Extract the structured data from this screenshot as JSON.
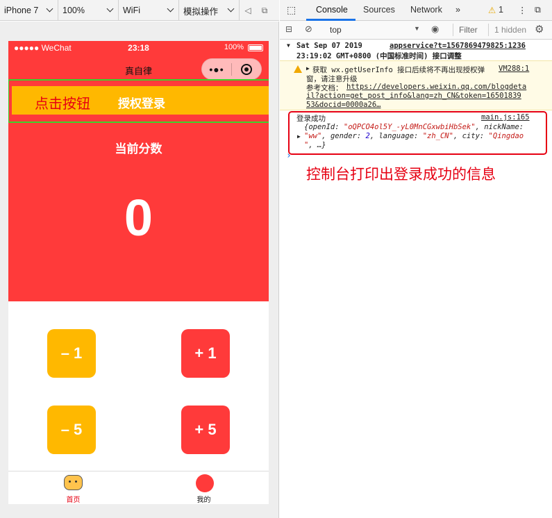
{
  "simulator": {
    "device": "iPhone 7",
    "zoom": "100%",
    "network": "WiFi",
    "operation": "模拟操作"
  },
  "phone": {
    "status_left": "●●●●● WeChat",
    "status_time": "23:18",
    "status_battery": "100%",
    "nav_title": "真自律",
    "capsule_dots": "•●•",
    "login_button": "授权登录",
    "score_label": "当前分数",
    "score_value": "0",
    "buttons": {
      "minus1": "– 1",
      "plus1": "+ 1",
      "minus5": "– 5",
      "plus5": "+ 5"
    },
    "tabs": {
      "home": "首页",
      "me": "我的"
    },
    "colors": {
      "red": "#ff3a3a",
      "yellow": "#ffb800"
    }
  },
  "devtools": {
    "tabs": [
      "Console",
      "Sources",
      "Network"
    ],
    "more": "»",
    "warning_count": "1",
    "context": "top",
    "filter_placeholder": "Filter",
    "hidden": "1 hidden",
    "log_header_date": "Sat Sep 07 2019",
    "log_header_time": "23:19:02 GMT+0800 (中国标准时间) 接口调整",
    "log_header_source": "appservice?t=1567869479825:1236",
    "warn_line1": "获取 wx.getUserInfo 接口后续将不再出现授权弹",
    "warn_source": "VM288:1",
    "warn_line2": "窗，请注意升级",
    "warn_line3_prefix": "参考文档：",
    "warn_line3_link": "https://developers.weixin.qq.com/blogdeta",
    "warn_line4": "il?action=get_post_info&lang=zh_CN&token=16501839",
    "warn_line5": "53&docid=0000a26…",
    "success_label": "登录成功",
    "success_source": "main.js:165",
    "obj_line1_key": "{openId: ",
    "obj_line1_val": "\"oQPCO4ol5Y_-yL0MnCGxwbiHbSek\"",
    "obj_line1_tail": ", nickName:",
    "obj_line2_val1": "\"ww\"",
    "obj_line2_mid1": ", gender: ",
    "obj_line2_num": "2",
    "obj_line2_mid2": ", language: ",
    "obj_line2_val2": "\"zh_CN\"",
    "obj_line2_mid3": ", city: ",
    "obj_line2_val3": "\"Qingdao",
    "obj_line3_val": "\"",
    "obj_line3_tail": ", …}",
    "prompt": "›"
  },
  "annotations": {
    "click_button": "点击按钮",
    "console_note": "控制台打印出登录成功的信息",
    "colors": {
      "green": "#3cd22b",
      "red": "#e60012"
    }
  }
}
